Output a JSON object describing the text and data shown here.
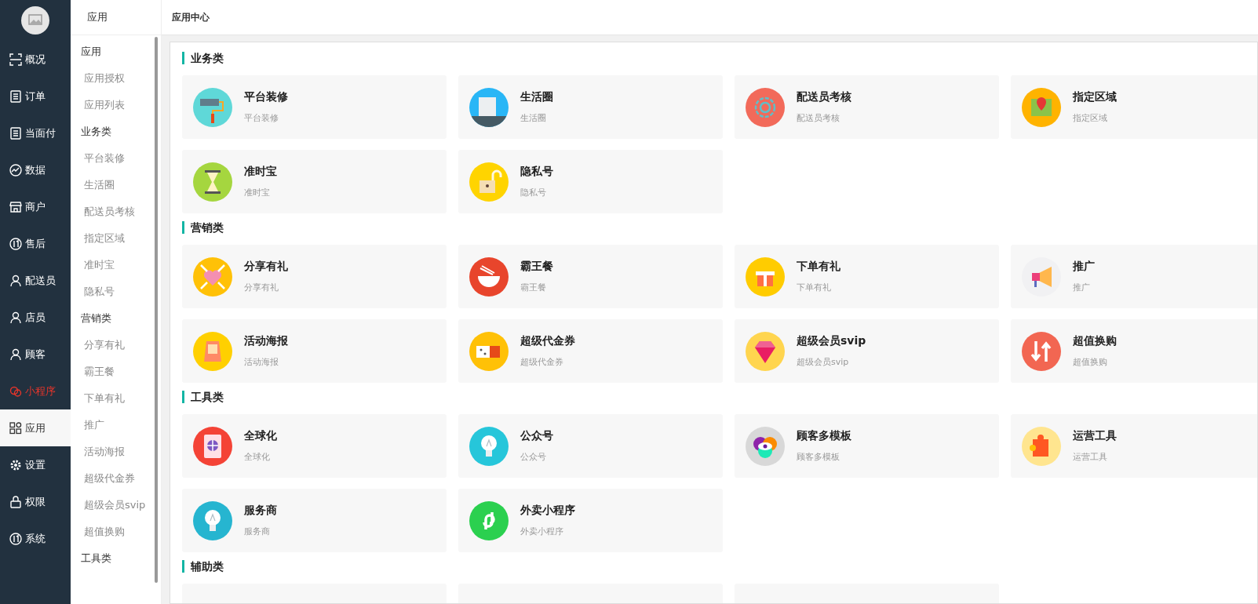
{
  "nav": {
    "items": [
      {
        "label": "概况",
        "selected": false,
        "highlighted": false
      },
      {
        "label": "订单",
        "selected": false,
        "highlighted": false
      },
      {
        "label": "当面付",
        "selected": false,
        "highlighted": false
      },
      {
        "label": "数据",
        "selected": false,
        "highlighted": false
      },
      {
        "label": "商户",
        "selected": false,
        "highlighted": false
      },
      {
        "label": "售后",
        "selected": false,
        "highlighted": false
      },
      {
        "label": "配送员",
        "selected": false,
        "highlighted": false
      },
      {
        "label": "店员",
        "selected": false,
        "highlighted": false
      },
      {
        "label": "顾客",
        "selected": false,
        "highlighted": false
      },
      {
        "label": "小程序",
        "selected": false,
        "highlighted": true
      },
      {
        "label": "应用",
        "selected": true,
        "highlighted": false
      },
      {
        "label": "设置",
        "selected": false,
        "highlighted": false
      },
      {
        "label": "权限",
        "selected": false,
        "highlighted": false
      },
      {
        "label": "系统",
        "selected": false,
        "highlighted": false
      }
    ]
  },
  "subnav": {
    "title": "应用",
    "groups": [
      {
        "heading": "应用",
        "items": [
          {
            "label": "应用授权"
          },
          {
            "label": "应用列表"
          }
        ]
      },
      {
        "heading": "业务类",
        "items": [
          {
            "label": "平台装修"
          },
          {
            "label": "生活圈"
          },
          {
            "label": "配送员考核"
          },
          {
            "label": "指定区域"
          },
          {
            "label": "准时宝"
          },
          {
            "label": "隐私号"
          }
        ]
      },
      {
        "heading": "营销类",
        "items": [
          {
            "label": "分享有礼"
          },
          {
            "label": "霸王餐"
          },
          {
            "label": "下单有礼"
          },
          {
            "label": "推广"
          },
          {
            "label": "活动海报"
          },
          {
            "label": "超级代金券"
          },
          {
            "label": "超级会员svip"
          },
          {
            "label": "超值换购"
          }
        ]
      },
      {
        "heading": "工具类"
      }
    ]
  },
  "header": {
    "title": "应用中心"
  },
  "sections": [
    {
      "title": "业务类",
      "apps": [
        {
          "name": "平台装修",
          "description": "平台装修"
        },
        {
          "name": "生活圈",
          "description": "生活圈"
        },
        {
          "name": "配送员考核",
          "description": "配送员考核"
        },
        {
          "name": "指定区域",
          "description": "指定区域"
        },
        {
          "name": "准时宝",
          "description": "准时宝"
        },
        {
          "name": "隐私号",
          "description": "隐私号"
        }
      ]
    },
    {
      "title": "营销类",
      "apps": [
        {
          "name": "分享有礼",
          "description": "分享有礼"
        },
        {
          "name": "霸王餐",
          "description": "霸王餐"
        },
        {
          "name": "下单有礼",
          "description": "下单有礼"
        },
        {
          "name": "推广",
          "description": "推广"
        },
        {
          "name": "活动海报",
          "description": "活动海报"
        },
        {
          "name": "超级代金券",
          "description": "超级代金券"
        },
        {
          "name": "超级会员svip",
          "description": "超级会员svip"
        },
        {
          "name": "超值换购",
          "description": "超值换购"
        }
      ]
    },
    {
      "title": "工具类",
      "apps": [
        {
          "name": "全球化",
          "description": "全球化"
        },
        {
          "name": "公众号",
          "description": "公众号"
        },
        {
          "name": "顾客多模板",
          "description": "顾客多模板"
        },
        {
          "name": "运营工具",
          "description": "运营工具"
        },
        {
          "name": "服务商",
          "description": "服务商"
        },
        {
          "name": "外卖小程序",
          "description": "外卖小程序"
        }
      ]
    },
    {
      "title": "辅助类"
    }
  ]
}
